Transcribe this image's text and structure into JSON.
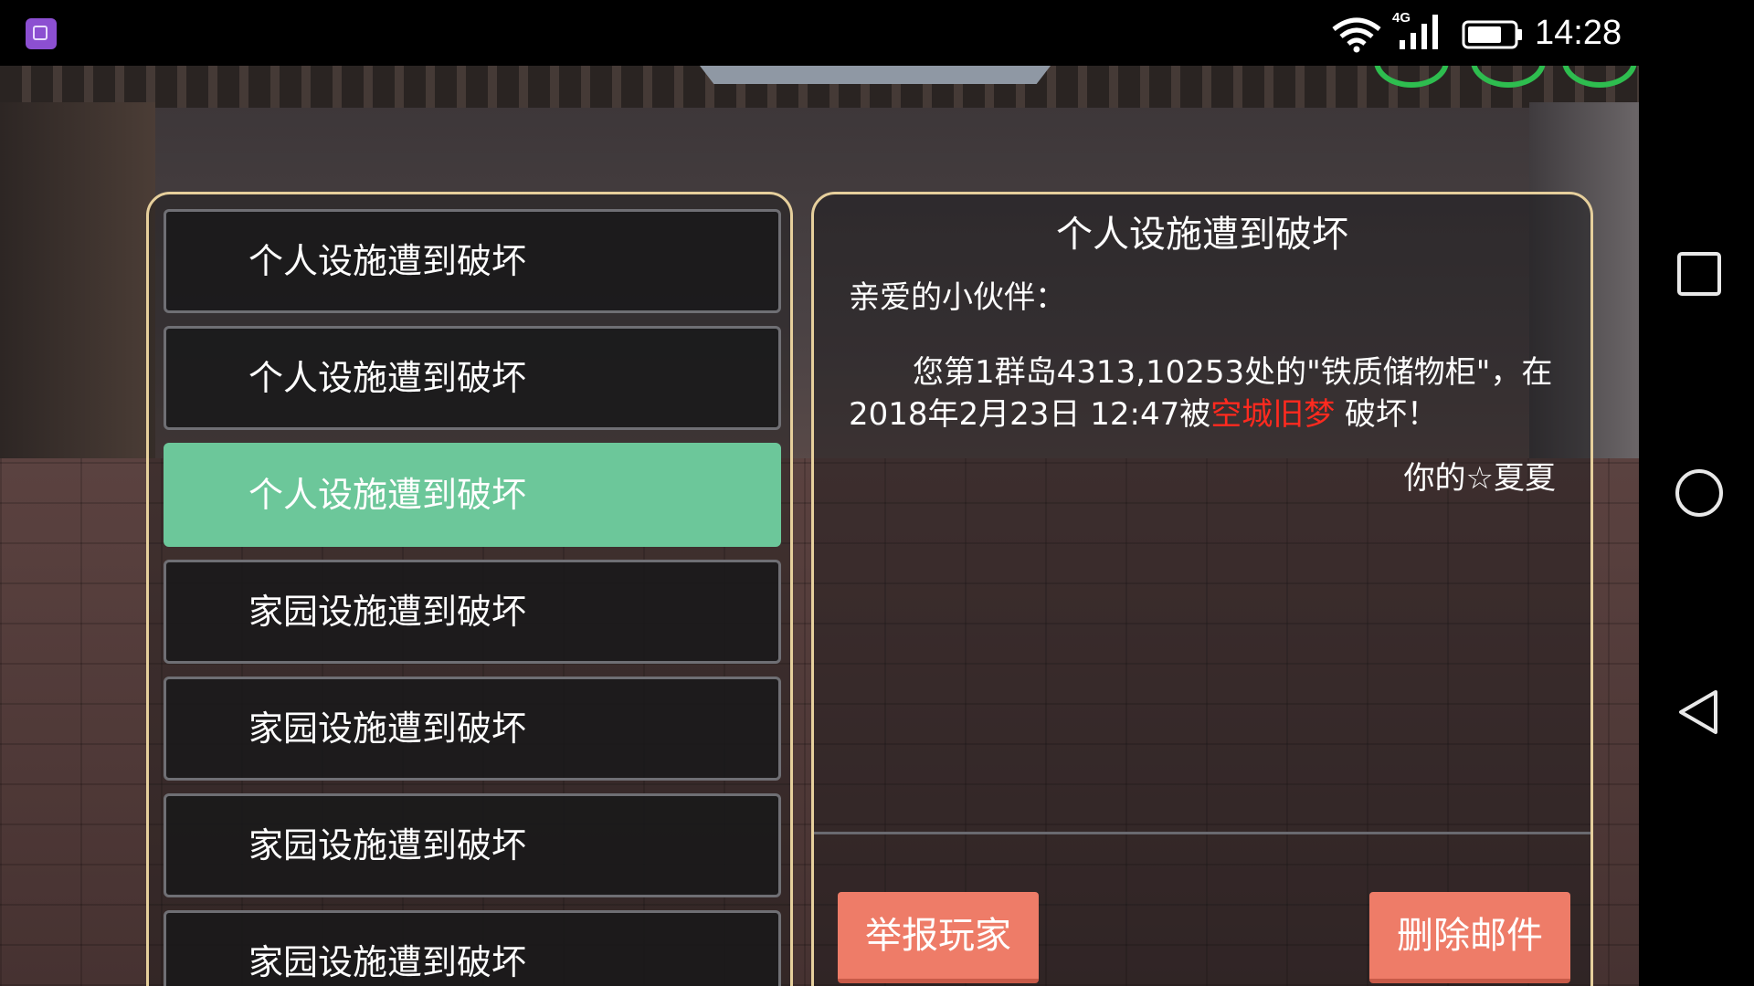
{
  "status_bar": {
    "time": "14:28",
    "network_label": "4G",
    "icons": [
      "app-icon",
      "wifi-icon",
      "signal-icon",
      "battery-icon"
    ]
  },
  "nav_bar": {
    "icons": [
      "recent-apps-square-icon",
      "home-circle-icon",
      "back-triangle-icon"
    ]
  },
  "mail_list": {
    "items": [
      {
        "label": "个人设施遭到破坏",
        "selected": false
      },
      {
        "label": "个人设施遭到破坏",
        "selected": false
      },
      {
        "label": "个人设施遭到破坏",
        "selected": true
      },
      {
        "label": "家园设施遭到破坏",
        "selected": false
      },
      {
        "label": "家园设施遭到破坏",
        "selected": false
      },
      {
        "label": "家园设施遭到破坏",
        "selected": false
      },
      {
        "label": "家园设施遭到破坏",
        "selected": false
      }
    ]
  },
  "mail_detail": {
    "title": "个人设施遭到破坏",
    "greeting": "亲爱的小伙伴：",
    "body_before": "您第1群岛4313,10253处的\"铁质储物柜\"，在2018年2月23日 12:47被",
    "attacker": "空城旧梦",
    "body_after": " 破坏！",
    "signature": "你的☆夏夏",
    "report_button": "举报玩家",
    "delete_button": "删除邮件"
  },
  "colors": {
    "selected_item": "#6cc79a",
    "panel_border": "#e6cf9c",
    "action_button": "#ee7c68",
    "attacker_name": "#ff2a1f"
  }
}
